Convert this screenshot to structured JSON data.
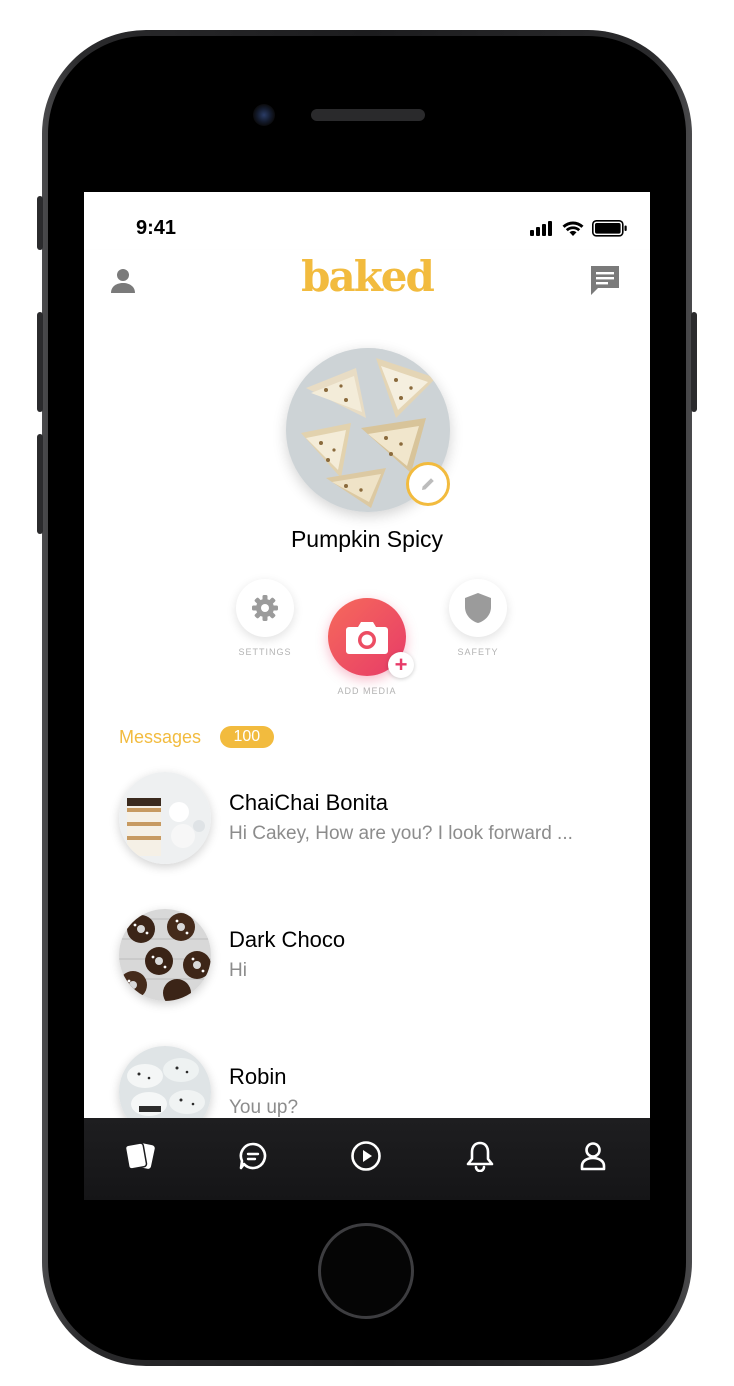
{
  "status_bar": {
    "time": "9:41"
  },
  "header": {
    "brand": "baked"
  },
  "profile": {
    "name": "Pumpkin Spicy"
  },
  "actions": {
    "settings_label": "SETTINGS",
    "add_media_label": "ADD MEDIA",
    "safety_label": "SAFETY"
  },
  "messages": {
    "title": "Messages",
    "count": "100",
    "items": [
      {
        "name": "ChaiChai Bonita",
        "preview": "Hi Cakey, How are you? I look forward ..."
      },
      {
        "name": "Dark Choco",
        "preview": "Hi"
      },
      {
        "name": "Robin",
        "preview": "You up?"
      }
    ]
  },
  "tabbar": {
    "tabs": [
      {
        "icon": "cards-icon",
        "active": true
      },
      {
        "icon": "chat-bubble-icon",
        "active": false
      },
      {
        "icon": "play-icon",
        "active": false
      },
      {
        "icon": "bell-icon",
        "active": false
      },
      {
        "icon": "user-icon",
        "active": false
      }
    ]
  },
  "colors": {
    "brand": "#f2bb3e",
    "accent": "#e73b68",
    "tabbar": "#1b1b1d"
  }
}
